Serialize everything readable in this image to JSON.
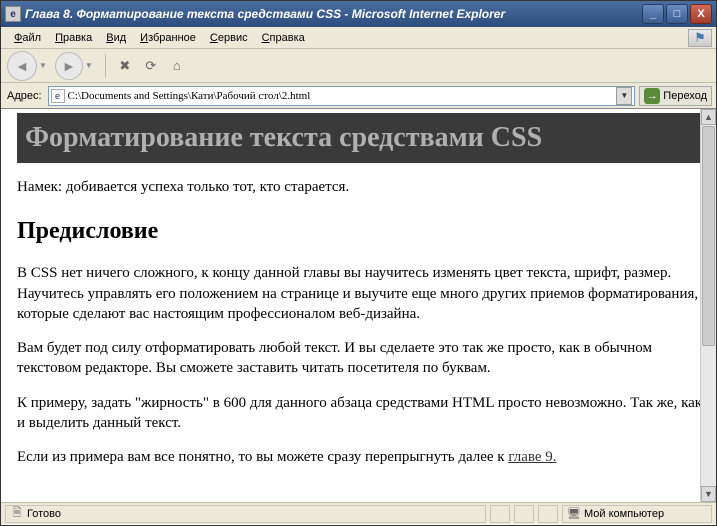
{
  "window": {
    "title": "Глава 8. Форматирование текста средствами CSS - Microsoft Internet Explorer"
  },
  "menu": {
    "file": "Файл",
    "edit": "Правка",
    "view": "Вид",
    "favorites": "Избранное",
    "tools": "Сервис",
    "help": "Справка"
  },
  "addressbar": {
    "label": "Адрес:",
    "value": "C:\\Documents and Settings\\Кати\\Рабочий стол\\2.html",
    "go": "Переход"
  },
  "page": {
    "h1": "Форматирование текста средствами CSS",
    "hint": "Намек: добивается успеха только тот, кто старается.",
    "h2": "Предисловие",
    "p1": "В CSS нет ничего сложного, к концу данной главы вы научитесь изменять цвет текста, шрифт, размер. Научитесь управлять его положением на странице и выучите еще много других приемов форматирования, которые сделают вас настоящим профессионалом веб-дизайна.",
    "p2": "Вам будет под силу отформатировать любой текст. И вы сделаете это так же просто, как в обычном текстовом редакторе. Вы сможете заставить читать посетителя по буквам.",
    "p3": "К примеру, задать \"жирность\" в 600 для данного абзаца средствами HTML просто невозможно. Так же, как и выделить данный текст.",
    "p4_prefix": "Если из примера вам все понятно, то вы можете сразу перепрыгнуть далее к ",
    "p4_link": "главе 9."
  },
  "status": {
    "left": "Готово",
    "zone": "Мой компьютер"
  }
}
